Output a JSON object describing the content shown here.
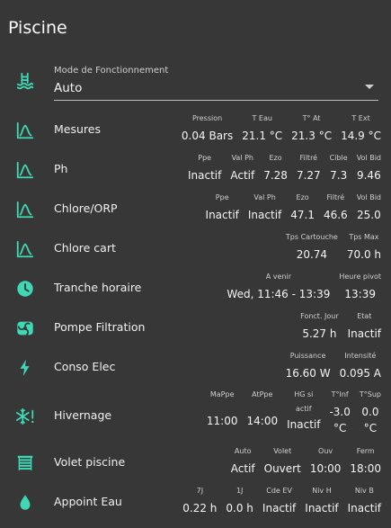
{
  "title": "Piscine",
  "colors": {
    "accent": "#3fd8b4",
    "background": "#373737"
  },
  "mode": {
    "label": "Mode de Fonctionnement",
    "value": "Auto",
    "icon": "pool-icon"
  },
  "rows": [
    {
      "name": "Mesures",
      "icon": "chart-bell-icon",
      "attrs": [
        {
          "label": "Pression",
          "value": "0.04 Bars"
        },
        {
          "label": "T Eau",
          "value": "21.1 °C"
        },
        {
          "label": "T° At",
          "value": "21.3 °C"
        },
        {
          "label": "T Ext",
          "value": "14.9 °C"
        }
      ]
    },
    {
      "name": "Ph",
      "icon": "chart-bell-icon",
      "attrs": [
        {
          "label": "Ppe",
          "value": "Inactif"
        },
        {
          "label": "Val Ph",
          "value": "Actif"
        },
        {
          "label": "Ezo",
          "value": "7.28"
        },
        {
          "label": "Filtré",
          "value": "7.27"
        },
        {
          "label": "Cible",
          "value": "7.3"
        },
        {
          "label": "Vol Bid",
          "value": "9.46"
        }
      ]
    },
    {
      "name": "Chlore/ORP",
      "icon": "chart-bell-icon",
      "attrs": [
        {
          "label": "Ppe",
          "value": "Inactif"
        },
        {
          "label": "Val Ph",
          "value": "Inactif"
        },
        {
          "label": "Ezo",
          "value": "47.1"
        },
        {
          "label": "Filtré",
          "value": "46.6"
        },
        {
          "label": "Vol Bid",
          "value": "25.0"
        }
      ]
    },
    {
      "name": "Chlore cart",
      "icon": "chart-bell-icon",
      "attrs": [
        {
          "label": "Tps Cartouche",
          "value": "20.74"
        },
        {
          "label": "Tps Max",
          "value": "70.0 h"
        }
      ]
    },
    {
      "name": "Tranche horaire",
      "icon": "clock-icon",
      "attrs": [
        {
          "label": "A venir",
          "value": "Wed, 11:46 - 13:39"
        },
        {
          "label": "Heure pivot",
          "value": "13:39"
        }
      ]
    },
    {
      "name": "Pompe Filtration",
      "icon": "pump-icon",
      "attrs": [
        {
          "label": "Fonct. Jour",
          "value": "5.27 h"
        },
        {
          "label": "Etat",
          "value": "Inactif"
        }
      ]
    },
    {
      "name": "Conso Elec",
      "icon": "flash-icon",
      "attrs": [
        {
          "label": "Puissance",
          "value": "16.60 W"
        },
        {
          "label": "Intensité",
          "value": "0.095 A"
        }
      ]
    },
    {
      "name": "Hivernage",
      "icon": "snowflake-alert-icon",
      "attrs": [
        {
          "label": "MaPpe",
          "value": "11:00"
        },
        {
          "label": "AtPpe",
          "value": "14:00"
        },
        {
          "label": "HG si",
          "value": "actif",
          "value2": "Inactif"
        },
        {
          "label": "T°Inf",
          "value": "-3.0",
          "value2": "°C"
        },
        {
          "label": "T°Sup",
          "value": "0.0",
          "value2": "°C"
        }
      ]
    },
    {
      "name": "Volet piscine",
      "icon": "blinds-icon",
      "attrs": [
        {
          "label": "Auto",
          "value": "Actif"
        },
        {
          "label": "Volet",
          "value": "Ouvert"
        },
        {
          "label": "Ouv",
          "value": "10:00"
        },
        {
          "label": "Ferm",
          "value": "18:00"
        }
      ]
    },
    {
      "name": "Appoint Eau",
      "icon": "water-drop-icon",
      "attrs": [
        {
          "label": "7J",
          "value": "0.22 h"
        },
        {
          "label": "1J",
          "value": "0.0 h"
        },
        {
          "label": "Cde EV",
          "value": "Inactif"
        },
        {
          "label": "Niv H",
          "value": "Inactif"
        },
        {
          "label": "Niv B",
          "value": "Inactif"
        }
      ]
    }
  ]
}
